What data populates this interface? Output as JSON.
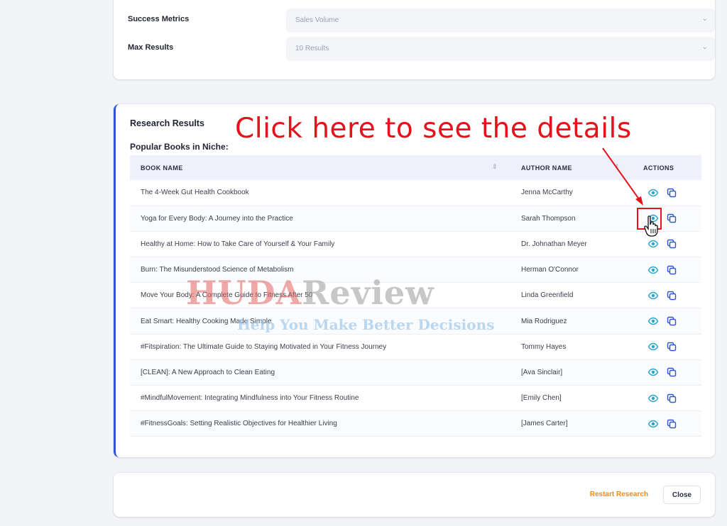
{
  "filters": [
    {
      "label": "Success Metrics",
      "value": "Sales Volume"
    },
    {
      "label": "Max Results",
      "value": "10 Results"
    }
  ],
  "results": {
    "title": "Research Results",
    "subtitle": "Popular Books in Niche:",
    "annotation": "Click here to see the details",
    "columns": {
      "book": "BOOK NAME",
      "author": "AUTHOR NAME",
      "actions": "ACTIONS"
    },
    "rows": [
      {
        "book": "The 4-Week Gut Health Cookbook",
        "author": "Jenna McCarthy"
      },
      {
        "book": "Yoga for Every Body: A Journey into the Practice",
        "author": "Sarah Thompson"
      },
      {
        "book": "Healthy at Home: How to Take Care of Yourself & Your Family",
        "author": "Dr. Johnathan Meyer"
      },
      {
        "book": "Burn: The Misunderstood Science of Metabolism",
        "author": "Herman O'Connor"
      },
      {
        "book": "Move Your Body: A Complete Guide to Fitness After 50",
        "author": "Linda Greenfield"
      },
      {
        "book": "Eat Smart: Healthy Cooking Made Simple",
        "author": "Mia Rodriguez"
      },
      {
        "book": "#Fitspiration: The Ultimate Guide to Staying Motivated in Your Fitness Journey",
        "author": "Tommy Hayes"
      },
      {
        "book": "[CLEAN]: A New Approach to Clean Eating",
        "author": "[Ava Sinclair]"
      },
      {
        "book": "#MindfulMovement: Integrating Mindfulness into Your Fitness Routine",
        "author": "[Emily Chen]"
      },
      {
        "book": "#FitnessGoals: Setting Realistic Objectives for Healthier Living",
        "author": "[James Carter]"
      }
    ]
  },
  "watermark": {
    "part1": "HUDA",
    "part2": "Review",
    "tagline": "Help You Make Better Decisions"
  },
  "footer": {
    "restart_label": "Restart Research",
    "close_label": "Close"
  },
  "icons": {
    "view": "eye-icon",
    "copy": "copy-icon",
    "sort": "sort-icon",
    "select": "chevron-down-icon"
  },
  "colors": {
    "accent": "#2f55d4",
    "annotation": "#e3121b",
    "restart": "#f08a1c",
    "icon": "#2aa3c9"
  }
}
